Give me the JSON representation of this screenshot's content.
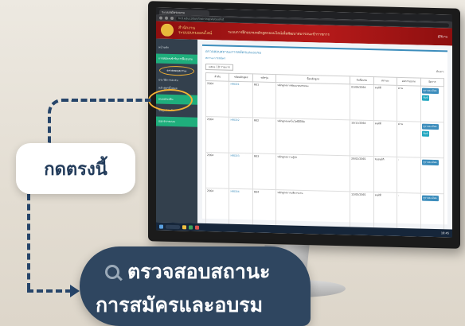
{
  "browser": {
    "tab_title": "ระบบสมัครอบรม",
    "url": "hrd.education/training/status/list"
  },
  "site": {
    "title_line1": "สำนักงาน",
    "title_line2": "ระบบอบรมออนไลน์",
    "subtitle": "ระบบการฝึกอบรมหลักสูตรออนไลน์เพื่อพัฒนาสมรรถนะข้าราชการ",
    "user": "ผู้ใช้งาน"
  },
  "sidebar": {
    "items": [
      {
        "label": "หน้าหลัก"
      },
      {
        "label": "การสมัครเข้ารับการฝึกอบรม"
      },
      {
        "label": "ตรวจสอบสถานะ"
      },
      {
        "label": "ประวัติการอบรม"
      },
      {
        "label": "หลักสูตรทั้งหมด"
      },
      {
        "label": "แบบประเมิน"
      },
      {
        "label": "ข้อมูลส่วนตัว"
      },
      {
        "label": "ออกจากระบบ"
      }
    ]
  },
  "panel": {
    "title": "ตรวจสอบสถานะการสมัครและอบรม",
    "subtitle": "สถานะการสมัคร",
    "show_entries": "แสดง 10 รายการ",
    "search_label": "ค้นหา:",
    "columns": [
      "ลำดับ",
      "รหัสหลักสูตร",
      "รหัสรุ่น",
      "ชื่อหลักสูตร",
      "วันที่อบรม",
      "สถานะ",
      "ผลการอบรม",
      "จัดการ"
    ],
    "rows": [
      {
        "no": "2564",
        "code": "HRD01",
        "batch": "R01",
        "name": "หลักสูตรการพัฒนาสมรรถนะ",
        "date": "01/09/2564",
        "status": "อนุมัติ",
        "result": "ผ่าน"
      },
      {
        "no": "2564",
        "code": "HRD02",
        "batch": "R02",
        "name": "หลักสูตรเทคโนโลยีดิจิทัล",
        "date": "15/11/2564",
        "status": "อนุมัติ",
        "result": "ผ่าน"
      },
      {
        "no": "2564",
        "code": "HRD03",
        "batch": "R03",
        "name": "หลักสูตรภาวะผู้นำ",
        "date": "20/02/2565",
        "status": "รออนุมัติ",
        "result": "-"
      },
      {
        "no": "2564",
        "code": "HRD04",
        "batch": "R04",
        "name": "หลักสูตรการบริหารงาน",
        "date": "12/05/2565",
        "status": "อนุมัติ",
        "result": "-"
      }
    ],
    "btn_view": "ดูรายละเอียด",
    "btn_cert": "พิมพ์"
  },
  "taskbar": {
    "time": "10:45"
  },
  "callout": {
    "label": "กดตรงนี้",
    "menu_line1": "ตรวจสอบสถานะ",
    "menu_line2": "การสมัครและอบรม"
  },
  "colors": {
    "header_red": "#b61a1a",
    "sidebar": "#33404d",
    "accent_green": "#1fae7c",
    "highlight": "#f2b134",
    "navy": "#2f4660"
  }
}
